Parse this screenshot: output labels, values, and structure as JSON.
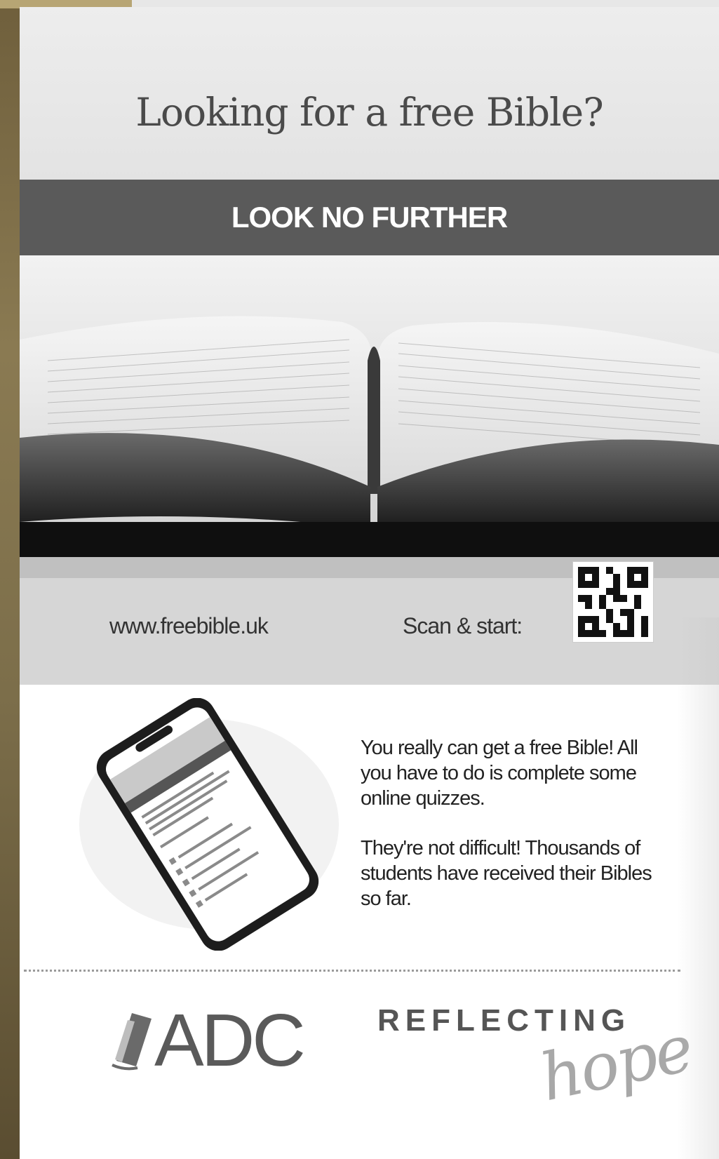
{
  "headline": "Looking for a free Bible?",
  "banner": "LOOK NO FURTHER",
  "url": "www.freebible.uk",
  "scan_label": "Scan & start:",
  "blurb": {
    "para1": "You really can get a free Bible! All you have to do is complete some online quizzes.",
    "para2": "They're not difficult! Thousands of students have received their Bibles so far."
  },
  "logos": {
    "adc": "ADC",
    "reflecting": "REFLECTING",
    "hope": "hope"
  },
  "icons": {
    "qr": "qr-code-icon",
    "book": "open-bible-photo",
    "phone": "smartphone-quiz-image",
    "adc_logo": "adc-book-logo-icon"
  }
}
